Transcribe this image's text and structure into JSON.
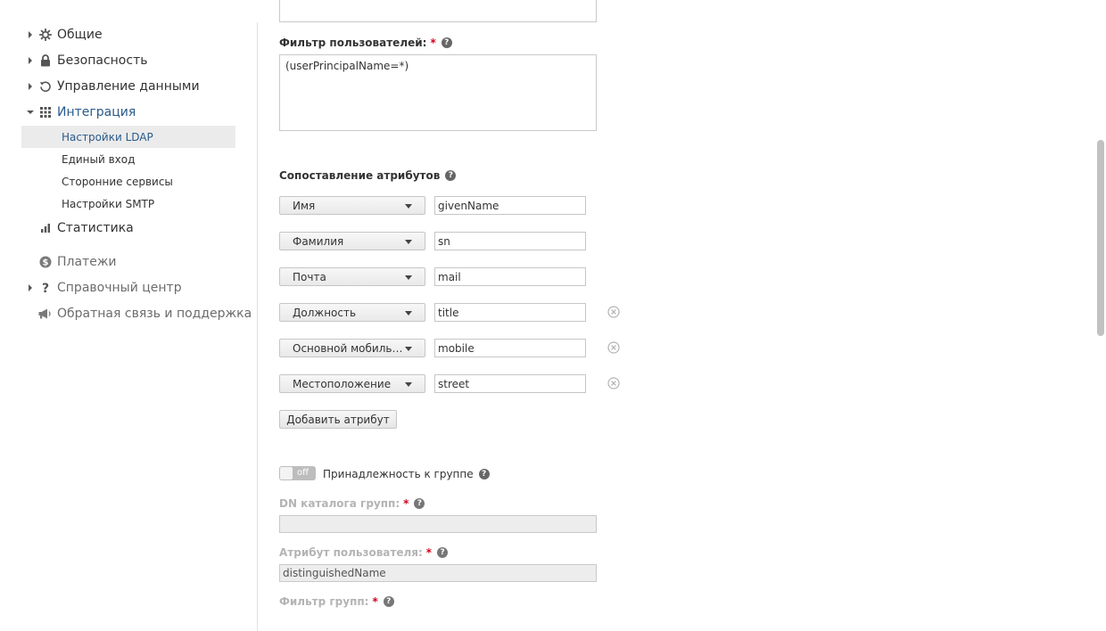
{
  "sidebar": {
    "items": [
      {
        "label": "Общие",
        "icon": "gear-icon"
      },
      {
        "label": "Безопасность",
        "icon": "lock-icon"
      },
      {
        "label": "Управление данными",
        "icon": "refresh-icon"
      },
      {
        "label": "Интеграция",
        "icon": "grid-icon"
      },
      {
        "label": "Статистика",
        "icon": "bar-chart-icon"
      },
      {
        "label": "Платежи",
        "icon": "dollar-icon"
      },
      {
        "label": "Справочный центр",
        "icon": "question-icon"
      },
      {
        "label": "Обратная связь и поддержка",
        "icon": "megaphone-icon"
      }
    ],
    "integration_subitems": [
      {
        "label": "Настройки LDAP",
        "selected": true
      },
      {
        "label": "Единый вход"
      },
      {
        "label": "Сторонние сервисы"
      },
      {
        "label": "Настройки SMTP"
      }
    ]
  },
  "form": {
    "user_filter": {
      "label": "Фильтр пользователей:",
      "required": "*",
      "value": "(userPrincipalName=*)"
    },
    "attribute_mapping": {
      "title": "Сопоставление атрибутов",
      "rows": [
        {
          "field": "Имя",
          "value": "givenName",
          "removable": false
        },
        {
          "field": "Фамилия",
          "value": "sn",
          "removable": false
        },
        {
          "field": "Почта",
          "value": "mail",
          "removable": false
        },
        {
          "field": "Должность",
          "value": "title",
          "removable": true
        },
        {
          "field": "Основной мобильный телефон",
          "value": "mobile",
          "removable": true
        },
        {
          "field": "Местоположение",
          "value": "street",
          "removable": true
        }
      ],
      "add_button": "Добавить атрибут"
    },
    "group_membership": {
      "toggle_state": "off",
      "label": "Принадлежность к группе"
    },
    "group_dn": {
      "label": "DN каталога групп:",
      "required": "*",
      "value": ""
    },
    "user_attribute": {
      "label": "Атрибут пользователя:",
      "required": "*",
      "value": "distinguishedName"
    },
    "group_filter": {
      "label": "Фильтр групп:",
      "required": "*"
    },
    "help_glyph": "?"
  },
  "colors": {
    "active_link": "#2a5a8a",
    "required": "#d0021b",
    "toggle_off": "#bdbdbd",
    "selected_row_bg": "#ebebeb"
  }
}
